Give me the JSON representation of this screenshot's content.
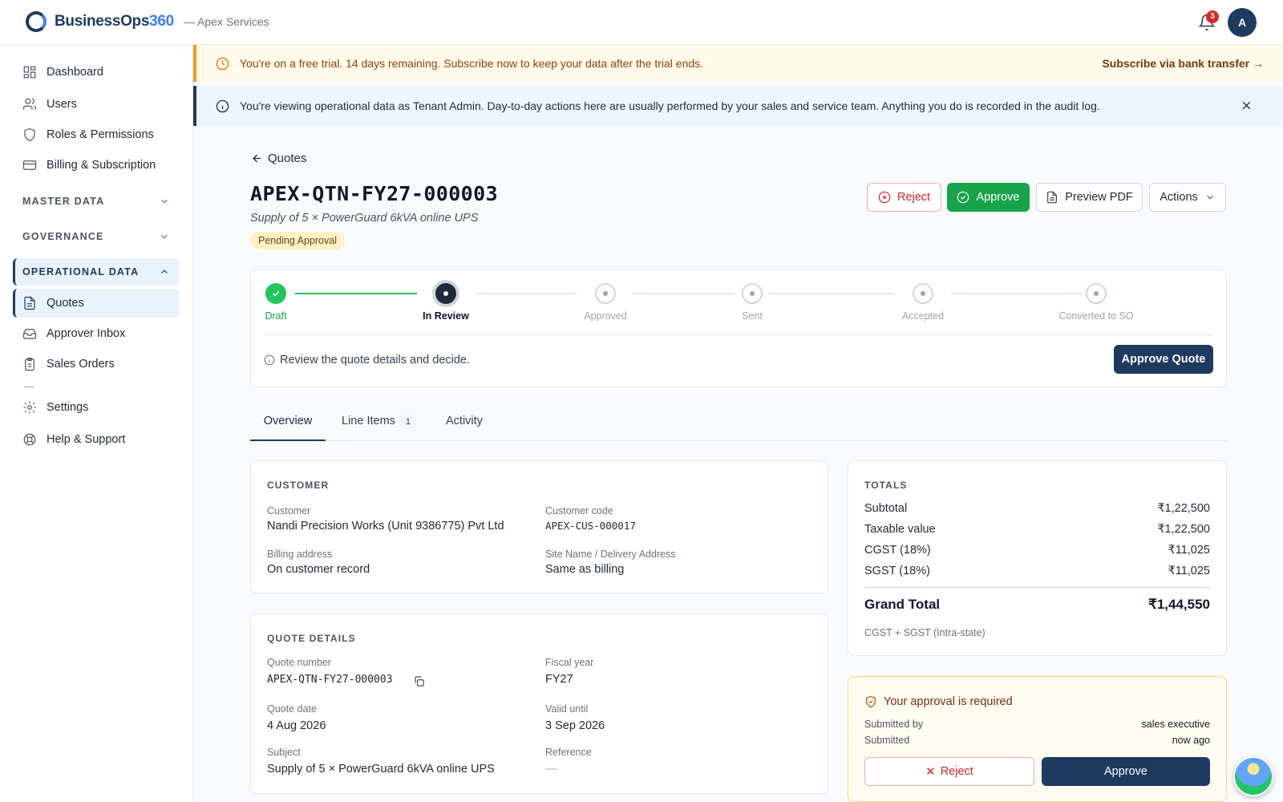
{
  "topbar": {
    "brand_main": "BusinessOps",
    "brand_accent": "360",
    "tenant": "— Apex Services",
    "notifications": "3",
    "avatar": "A"
  },
  "sidebar": {
    "dashboard": "Dashboard",
    "users": "Users",
    "roles": "Roles & Permissions",
    "billing": "Billing & Subscription",
    "master_data": "MASTER DATA",
    "governance": "GOVERNANCE",
    "operational_data": "OPERATIONAL DATA",
    "quotes": "Quotes",
    "approver_inbox": "Approver Inbox",
    "sales_orders": "Sales Orders",
    "settings": "Settings",
    "help": "Help & Support"
  },
  "trial_banner": {
    "text": "You're on a free trial. 14 days remaining. Subscribe now to keep your data after the trial ends.",
    "link": "Subscribe via bank transfer →"
  },
  "info_banner": {
    "text": "You're viewing operational data as Tenant Admin. Day-to-day actions here are usually performed by your sales and service team. Anything you do is recorded in the audit log."
  },
  "page": {
    "back": "Quotes",
    "title": "APEX-QTN-FY27-000003",
    "subtitle": "Supply of 5 × PowerGuard 6kVA online UPS",
    "status": "Pending Approval",
    "btn_reject": "Reject",
    "btn_approve": "Approve",
    "btn_pdf": "Preview PDF",
    "btn_actions": "Actions"
  },
  "stepper": {
    "steps": [
      "Draft",
      "In Review",
      "Approved",
      "Sent",
      "Accepted",
      "Converted to SO"
    ],
    "hint": "Review the quote details and decide.",
    "action": "Approve Quote"
  },
  "tabs": {
    "overview": "Overview",
    "line_items": "Line Items",
    "line_items_count": "1",
    "activity": "Activity"
  },
  "customer": {
    "heading": "CUSTOMER",
    "customer_label": "Customer",
    "customer_value": "Nandi Precision Works (Unit 9386775) Pvt Ltd",
    "code_label": "Customer code",
    "code_value": "APEX-CUS-000017",
    "billing_label": "Billing address",
    "billing_value": "On customer record",
    "site_label": "Site Name / Delivery Address",
    "site_value": "Same as billing"
  },
  "quote_details": {
    "heading": "QUOTE DETAILS",
    "number_label": "Quote number",
    "number_value": "APEX-QTN-FY27-000003",
    "fy_label": "Fiscal year",
    "fy_value": "FY27",
    "date_label": "Quote date",
    "date_value": "4 Aug 2026",
    "valid_label": "Valid until",
    "valid_value": "3 Sep 2026",
    "subject_label": "Subject",
    "subject_value": "Supply of 5 × PowerGuard 6kVA online UPS",
    "ref_label": "Reference",
    "ref_value": "—"
  },
  "totals": {
    "heading": "TOTALS",
    "subtotal_label": "Subtotal",
    "subtotal": "₹1,22,500",
    "taxable_label": "Taxable value",
    "taxable": "₹1,22,500",
    "cgst_label": "CGST (18%)",
    "cgst": "₹11,025",
    "sgst_label": "SGST (18%)",
    "sgst": "₹11,025",
    "grand_label": "Grand Total",
    "grand": "₹1,44,550",
    "note": "CGST + SGST (Intra-state)"
  },
  "approval": {
    "heading": "Your approval is required",
    "submitted_by_label": "Submitted by",
    "submitted_by": "sales executive",
    "submitted_label": "Submitted",
    "submitted": "now ago",
    "reject": "Reject",
    "approve": "Approve"
  }
}
